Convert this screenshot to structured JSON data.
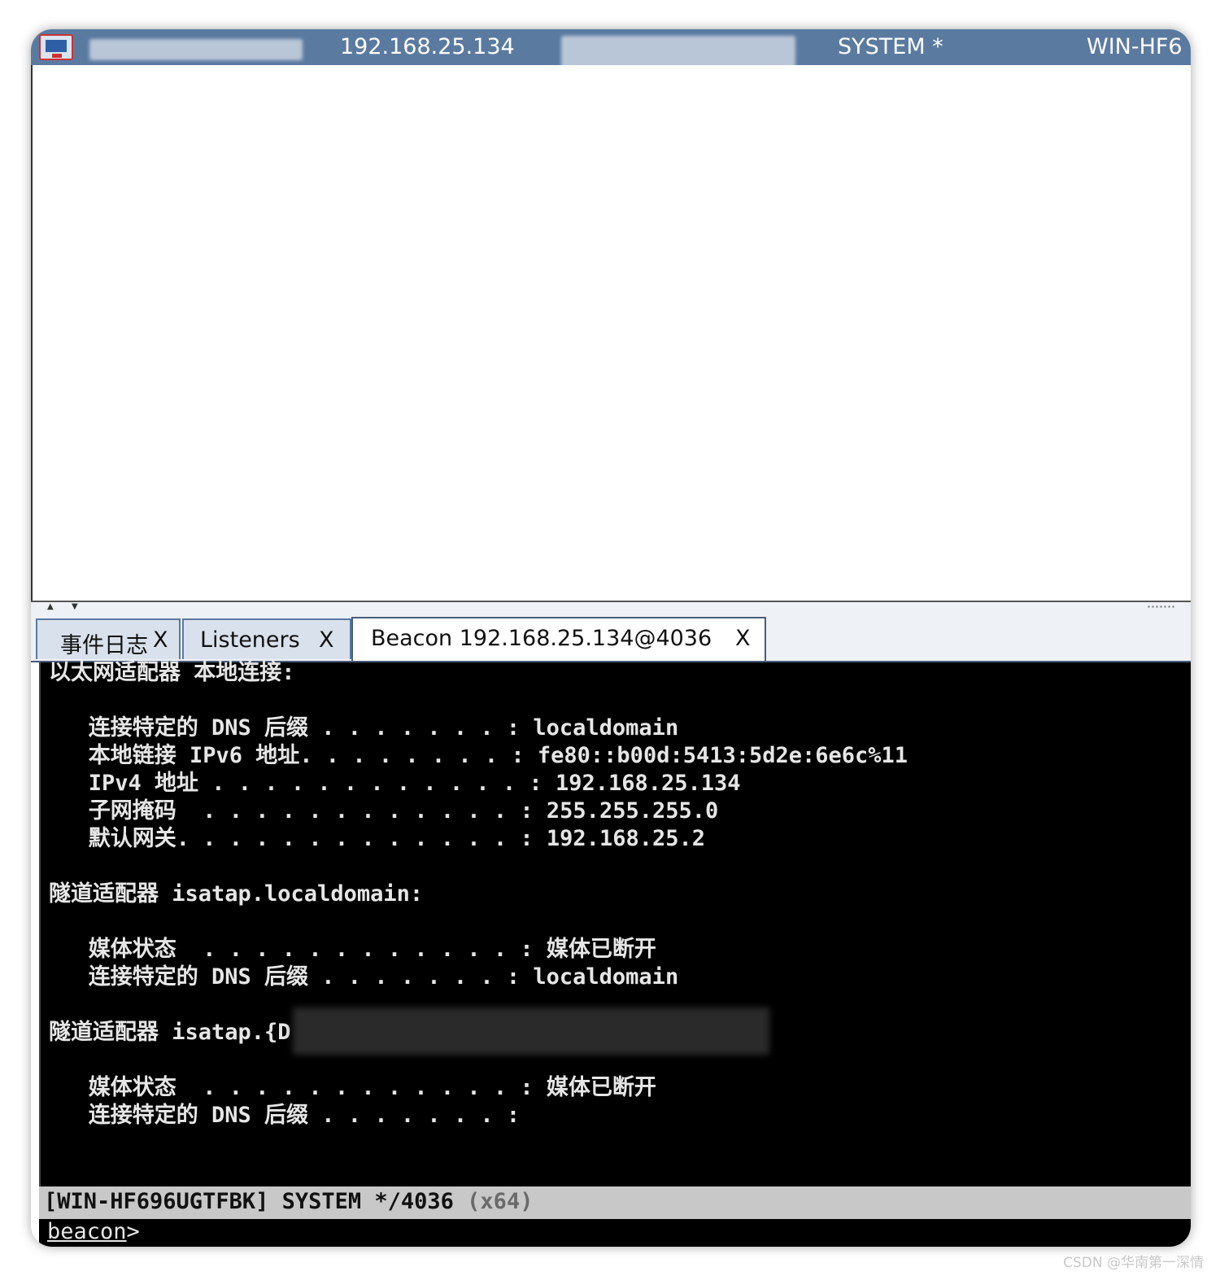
{
  "session": {
    "internal_ip": "192.168.25.134",
    "user": "SYSTEM *",
    "computer": "WIN-HF6"
  },
  "tabs": [
    {
      "label": "事件日志",
      "close": "X"
    },
    {
      "label": "Listeners",
      "close": "X"
    },
    {
      "label": "Beacon 192.168.25.134@4036",
      "close": "X"
    }
  ],
  "console": {
    "lines": [
      "以太网适配器 本地连接:",
      "",
      "   连接特定的 DNS 后缀 . . . . . . . : localdomain",
      "   本地链接 IPv6 地址. . . . . . . . : fe80::b00d:5413:5d2e:6e6c%11",
      "   IPv4 地址 . . . . . . . . . . . . : 192.168.25.134",
      "   子网掩码  . . . . . . . . . . . . : 255.255.255.0",
      "   默认网关. . . . . . . . . . . . . : 192.168.25.2",
      "",
      "隧道适配器 isatap.localdomain:",
      "",
      "   媒体状态  . . . . . . . . . . . . : 媒体已断开",
      "   连接特定的 DNS 后缀 . . . . . . . : localdomain",
      "",
      "隧道适配器 isatap.{D",
      "",
      "   媒体状态  . . . . . . . . . . . . : 媒体已断开",
      "   连接特定的 DNS 后缀 . . . . . . . :"
    ]
  },
  "status": {
    "text": "[WIN-HF696UGTFBK] SYSTEM */4036 ",
    "arch": "(x64)"
  },
  "prompt": {
    "label": "beacon",
    "suffix": ">"
  },
  "watermark": "CSDN @华南第一深情"
}
